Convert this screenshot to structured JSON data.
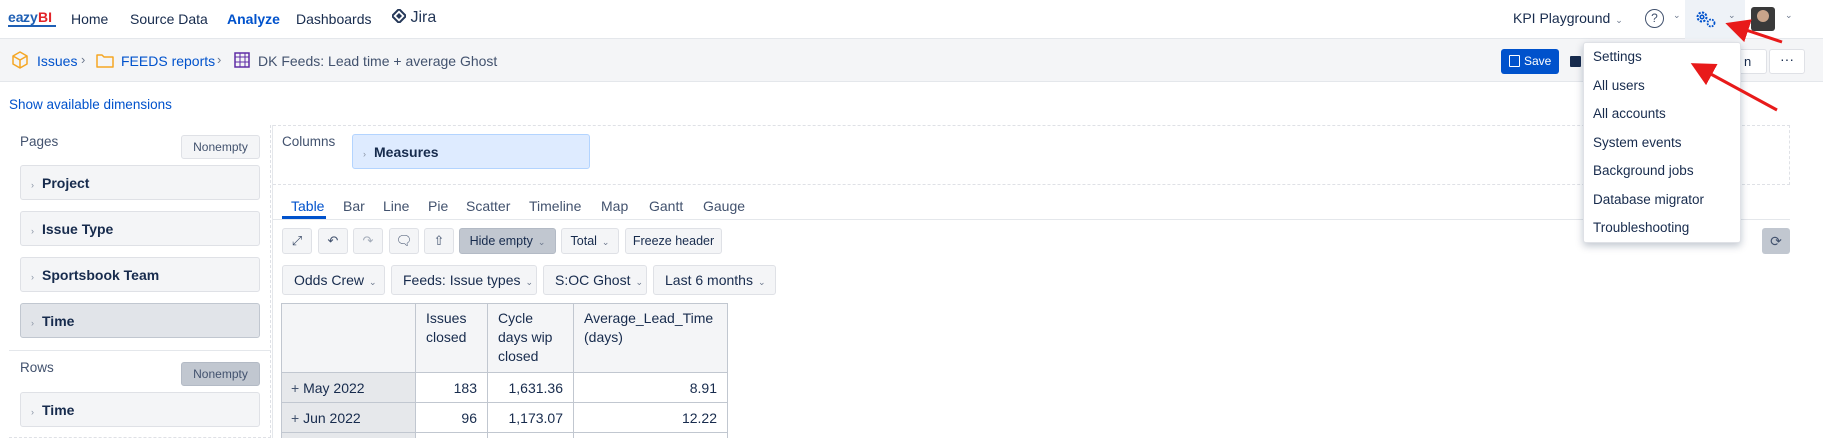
{
  "brand": "eazyBI",
  "nav": {
    "items": [
      "Home",
      "Source Data",
      "Analyze",
      "Dashboards"
    ],
    "jira_label": "Jira",
    "account": "KPI Playground",
    "help_glyph": "?"
  },
  "breadcrumb": {
    "items": [
      "Issues",
      "FEEDS reports",
      "DK Feeds: Lead time + average Ghost"
    ]
  },
  "actions": {
    "save_label": "Save",
    "open_fragment": "n",
    "more_label": "···"
  },
  "show_dims_label": "Show available dimensions",
  "pages": {
    "label": "Pages",
    "nonempty_label": "Nonempty",
    "dimensions": [
      "Project",
      "Issue Type",
      "Sportsbook Team",
      "Time"
    ]
  },
  "rows": {
    "label": "Rows",
    "nonempty_label": "Nonempty",
    "dimensions": [
      "Time"
    ]
  },
  "columns": {
    "label": "Columns",
    "dimensions": [
      "Measures"
    ]
  },
  "view_tabs": [
    "Table",
    "Bar",
    "Line",
    "Pie",
    "Scatter",
    "Timeline",
    "Map",
    "Gantt",
    "Gauge"
  ],
  "toolbar": {
    "hide_empty": "Hide empty",
    "total": "Total",
    "freeze_header": "Freeze header"
  },
  "filters": [
    "Odds Crew",
    "Feeds: Issue types",
    "S:OC Ghost",
    "Last 6 months"
  ],
  "table": {
    "headers": [
      [
        "Issues",
        "closed"
      ],
      [
        "Cycle",
        "days wip",
        "closed"
      ],
      [
        "Average_Lead_Time",
        "(days)"
      ]
    ],
    "rows": [
      {
        "label": "May 2022",
        "values": [
          "183",
          "1,631.36",
          "8.91"
        ]
      },
      {
        "label": "Jun 2022",
        "values": [
          "96",
          "1,173.07",
          "12.22"
        ]
      }
    ]
  },
  "settings_menu": {
    "items": [
      "Settings",
      "All users",
      "All accounts",
      "System events",
      "Background jobs",
      "Database migrator",
      "Troubleshooting"
    ]
  },
  "colors": {
    "primary": "#0052cc",
    "annotation_arrow": "#e81a1a"
  }
}
